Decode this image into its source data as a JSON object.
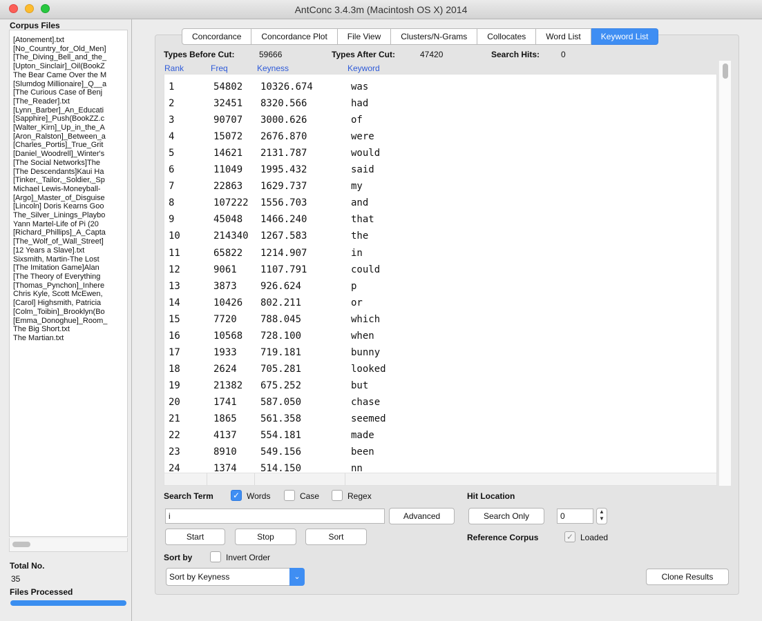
{
  "window": {
    "title": "AntConc 3.4.3m (Macintosh OS X) 2014"
  },
  "sidebar": {
    "corpus_heading": "Corpus Files",
    "files": [
      "[Atonement].txt",
      "[No_Country_for_Old_Men]",
      "[The_Diving_Bell_and_the_",
      "[Upton_Sinclair]_Oil(BookZ",
      "The Bear Came Over the M",
      "[Slumdog Millionaire]_Q__a",
      "[The Curious Case of Benj",
      "[The_Reader].txt",
      "[Lynn_Barber]_An_Educati",
      "[Sapphire]_Push(BookZZ.c",
      "[Walter_Kirn]_Up_in_the_A",
      "[Aron_Ralston]_Between_a",
      "[Charles_Portis]_True_Grit",
      "[Daniel_Woodrell]_Winter's",
      "[The Social Networks]The",
      "[The Descendants]Kaui Ha",
      "[Tinker,_Tailor,_Soldier,_Sp",
      "Michael Lewis-Moneyball-",
      "[Argo]_Master_of_Disguise",
      "[Lincoln] Doris Kearns Goo",
      "The_Silver_Linings_Playbo",
      "Yann Martel-Life of Pi (20",
      "[Richard_Phillips]_A_Capta",
      "[The_Wolf_of_Wall_Street]",
      "[12 Years a Slave].txt",
      "Sixsmith, Martin-The Lost",
      "[The Imitation Game]Alan",
      "[The Theory of Everything",
      "[Thomas_Pynchon]_Inhere",
      "Chris Kyle, Scott McEwen,",
      "[Carol] Highsmith, Patricia",
      "[Colm_Toibin]_Brooklyn(Bo",
      "[Emma_Donoghue]_Room_",
      "The Big Short.txt",
      "The Martian.txt"
    ],
    "total_label": "Total No.",
    "total_value": "35",
    "processed_label": "Files Processed",
    "processed_progress": 1.0
  },
  "tabs": [
    {
      "label": "Concordance",
      "active": false
    },
    {
      "label": "Concordance Plot",
      "active": false
    },
    {
      "label": "File View",
      "active": false
    },
    {
      "label": "Clusters/N-Grams",
      "active": false
    },
    {
      "label": "Collocates",
      "active": false
    },
    {
      "label": "Word List",
      "active": false
    },
    {
      "label": "Keyword List",
      "active": true
    }
  ],
  "stats": {
    "types_before_label": "Types Before Cut:",
    "types_before_value": "59666",
    "types_after_label": "Types After Cut:",
    "types_after_value": "47420",
    "search_hits_label": "Search Hits:",
    "search_hits_value": "0"
  },
  "table": {
    "headers": {
      "rank": "Rank",
      "freq": "Freq",
      "keyness": "Keyness",
      "keyword": "Keyword"
    },
    "rows": [
      {
        "rank": "1",
        "freq": "54802",
        "keyness": "10326.674",
        "keyword": "was"
      },
      {
        "rank": "2",
        "freq": "32451",
        "keyness": "8320.566",
        "keyword": "had"
      },
      {
        "rank": "3",
        "freq": "90707",
        "keyness": "3000.626",
        "keyword": "of"
      },
      {
        "rank": "4",
        "freq": "15072",
        "keyness": "2676.870",
        "keyword": "were"
      },
      {
        "rank": "5",
        "freq": "14621",
        "keyness": "2131.787",
        "keyword": "would"
      },
      {
        "rank": "6",
        "freq": "11049",
        "keyness": "1995.432",
        "keyword": "said"
      },
      {
        "rank": "7",
        "freq": "22863",
        "keyness": "1629.737",
        "keyword": "my"
      },
      {
        "rank": "8",
        "freq": "107222",
        "keyness": "1556.703",
        "keyword": "and"
      },
      {
        "rank": "9",
        "freq": "45048",
        "keyness": "1466.240",
        "keyword": "that"
      },
      {
        "rank": "10",
        "freq": "214340",
        "keyness": "1267.583",
        "keyword": "the"
      },
      {
        "rank": "11",
        "freq": "65822",
        "keyness": "1214.907",
        "keyword": "in"
      },
      {
        "rank": "12",
        "freq": "9061",
        "keyness": "1107.791",
        "keyword": "could"
      },
      {
        "rank": "13",
        "freq": "3873",
        "keyness": "926.624",
        "keyword": "p"
      },
      {
        "rank": "14",
        "freq": "10426",
        "keyness": "802.211",
        "keyword": "or"
      },
      {
        "rank": "15",
        "freq": "7720",
        "keyness": "788.045",
        "keyword": "which"
      },
      {
        "rank": "16",
        "freq": "10568",
        "keyness": "728.100",
        "keyword": "when"
      },
      {
        "rank": "17",
        "freq": "1933",
        "keyness": "719.181",
        "keyword": "bunny"
      },
      {
        "rank": "18",
        "freq": "2624",
        "keyness": "705.281",
        "keyword": "looked"
      },
      {
        "rank": "19",
        "freq": "21382",
        "keyness": "675.252",
        "keyword": "but"
      },
      {
        "rank": "20",
        "freq": "1741",
        "keyness": "587.050",
        "keyword": "chase"
      },
      {
        "rank": "21",
        "freq": "1865",
        "keyness": "561.358",
        "keyword": "seemed"
      },
      {
        "rank": "22",
        "freq": "4137",
        "keyness": "554.181",
        "keyword": "made"
      },
      {
        "rank": "23",
        "freq": "8910",
        "keyness": "549.156",
        "keyword": "been"
      },
      {
        "rank": "24",
        "freq": "1374",
        "keyness": "514.150",
        "keyword": "nn"
      }
    ]
  },
  "search": {
    "term_label": "Search Term",
    "words_label": "Words",
    "words_checked": true,
    "case_label": "Case",
    "case_checked": false,
    "regex_label": "Regex",
    "regex_checked": false,
    "query_value": "i",
    "advanced_label": "Advanced",
    "start_label": "Start",
    "stop_label": "Stop",
    "sort_label": "Sort"
  },
  "hit_location": {
    "label": "Hit Location",
    "search_only_label": "Search Only",
    "value": "0"
  },
  "reference_corpus": {
    "label": "Reference Corpus",
    "loaded_label": "Loaded",
    "loaded_checked": true
  },
  "sort": {
    "label": "Sort by",
    "invert_label": "Invert Order",
    "invert_checked": false,
    "selected": "Sort by Keyness"
  },
  "clone_label": "Clone Results",
  "icons": {
    "checkmark": "check-icon",
    "chevron": "chevron-down-icon",
    "stepper": "stepper-icon"
  },
  "colors": {
    "accent": "#3f8ef3",
    "column_header": "#2e5ad8"
  }
}
